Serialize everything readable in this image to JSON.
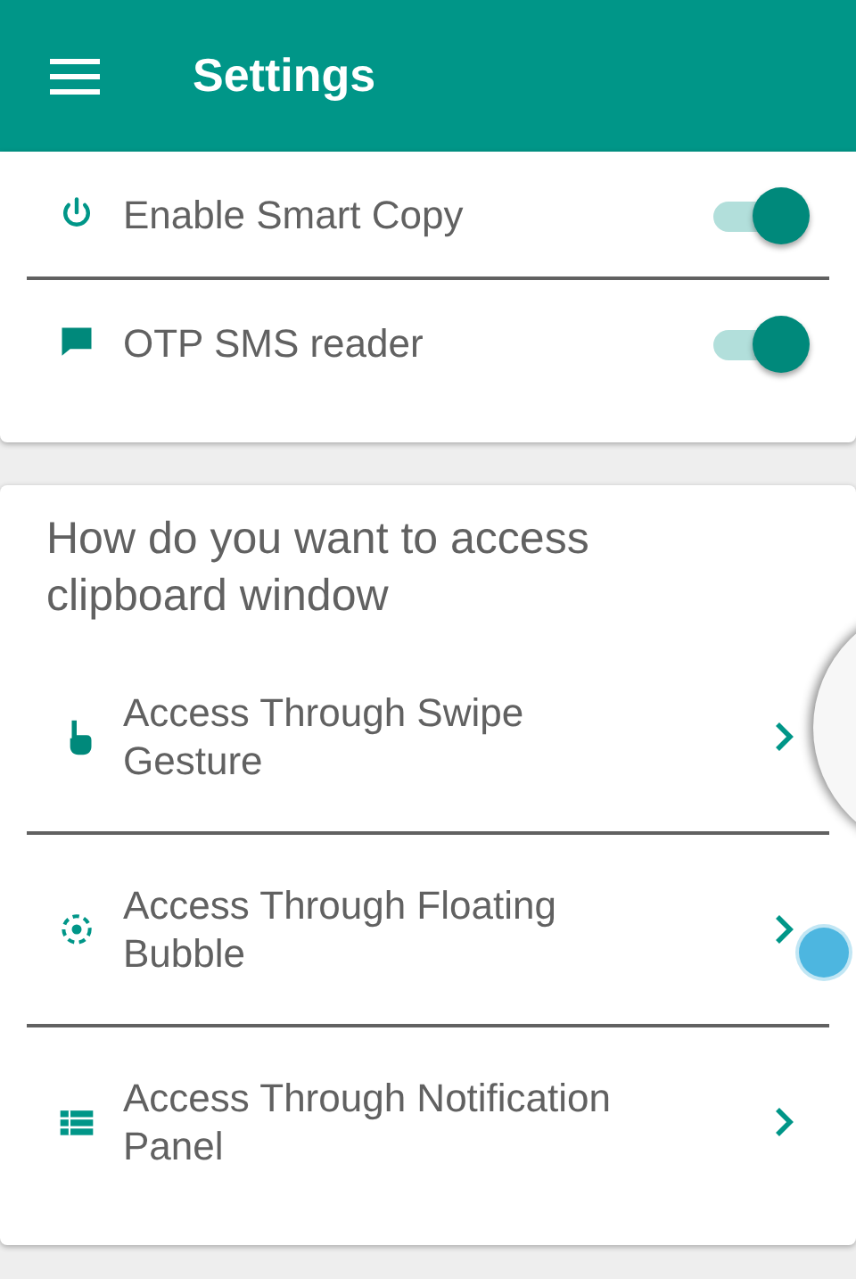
{
  "app_bar": {
    "title": "Settings"
  },
  "toggles": [
    {
      "label": "Enable Smart Copy",
      "on": true
    },
    {
      "label": "OTP SMS reader",
      "on": true
    }
  ],
  "access_section": {
    "title": "How do you want to access clipboard window",
    "options": [
      {
        "label": "Access Through Swipe Gesture"
      },
      {
        "label": "Access Through Floating Bubble"
      },
      {
        "label": "Access Through Notification Panel"
      }
    ]
  }
}
